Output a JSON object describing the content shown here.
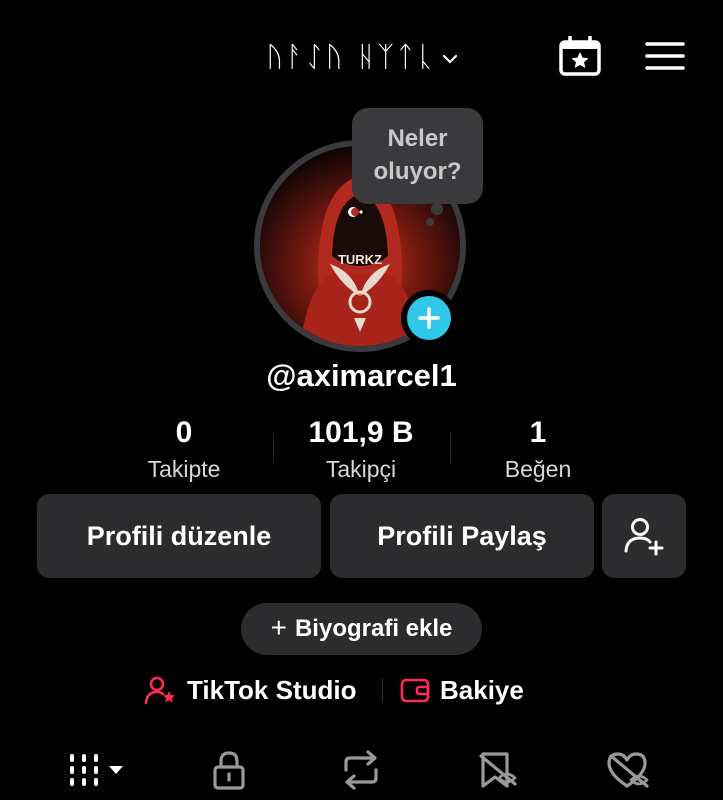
{
  "header": {
    "title": "ᚢᚨᛇᚢ ᚺᛉᛏᚳ",
    "chevron_icon": "chevron-down-icon",
    "calendar_icon": "calendar-star-icon",
    "menu_icon": "hamburger-menu-icon"
  },
  "profile": {
    "bubble_text": "Neler oluyor?",
    "username": "@aximarcel1",
    "avatar_text": "TURKZ"
  },
  "stats": [
    {
      "value": "0",
      "label": "Takipte"
    },
    {
      "value": "101,9 B",
      "label": "Takipçi"
    },
    {
      "value": "1",
      "label": "Beğen"
    }
  ],
  "actions": {
    "edit_profile": "Profili düzenle",
    "share_profile": "Profili Paylaş",
    "add_friend_icon": "add-user-icon"
  },
  "bio": {
    "add_label": "Biyografi ekle"
  },
  "links": {
    "studio": "TikTok Studio",
    "balance": "Bakiye"
  },
  "tabs": [
    "videos-grid-icon",
    "lock-icon",
    "repost-icon",
    "favorites-icon",
    "liked-icon"
  ],
  "colors": {
    "accent_cyan": "#2fc8e8",
    "accent_red": "#fe2c55",
    "surface": "#2c2c2e"
  }
}
